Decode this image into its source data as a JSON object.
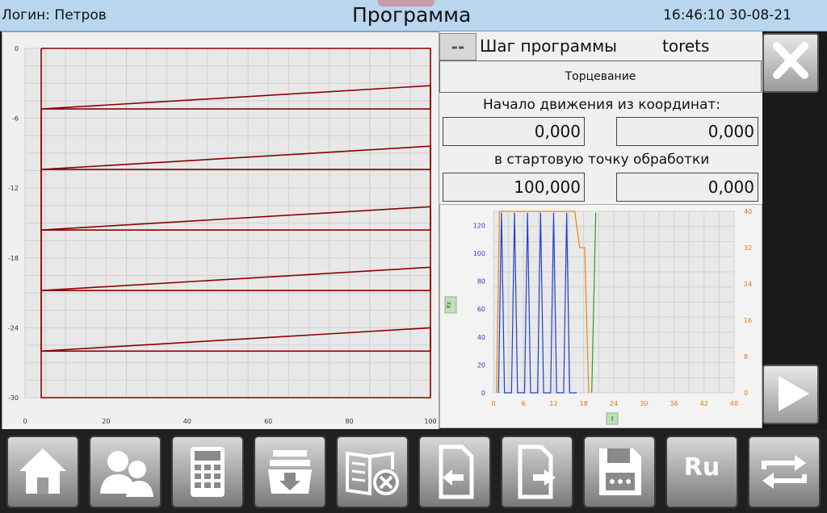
{
  "header": {
    "login": "Логин: Петров",
    "title": "Программа",
    "datetime": "16:46:10 30-08-21"
  },
  "program": {
    "dash_label": "--",
    "step_label": "Шаг программы",
    "step_name": "torets",
    "step_description": "Торцевание",
    "start_label": "Начало движения из координат:",
    "start_x": "0,000",
    "start_z": "0,000",
    "target_label": "в стартовую точку обработки",
    "target_x": "100,000",
    "target_z": "0,000"
  },
  "chart_data": [
    {
      "type": "line",
      "x_ticks": [
        "0",
        "20",
        "40",
        "60",
        "80",
        "100"
      ],
      "y_ticks": [
        "0",
        "-6",
        "-12",
        "-18",
        "-24",
        "-30"
      ],
      "xlim": [
        0,
        100
      ],
      "ylim": [
        -30,
        0
      ],
      "grid": true,
      "series": [
        {
          "values": [
            [
              4,
              0
            ],
            [
              100,
              0
            ],
            [
              100,
              -30
            ],
            [
              4,
              -30
            ],
            [
              4,
              0
            ]
          ]
        },
        {
          "values": [
            [
              4,
              -5.2
            ],
            [
              100,
              -3.2
            ],
            [
              100,
              -5.2
            ],
            [
              4,
              -5.2
            ],
            [
              4,
              -10.4
            ],
            [
              100,
              -8.4
            ],
            [
              100,
              -10.4
            ],
            [
              4,
              -10.4
            ],
            [
              4,
              -15.6
            ],
            [
              100,
              -13.6
            ],
            [
              100,
              -15.6
            ],
            [
              4,
              -15.6
            ],
            [
              4,
              -20.8
            ],
            [
              100,
              -18.8
            ],
            [
              100,
              -20.8
            ],
            [
              4,
              -20.8
            ],
            [
              4,
              -26
            ],
            [
              100,
              -24
            ],
            [
              100,
              -26
            ],
            [
              4,
              -26
            ]
          ]
        }
      ],
      "color": "#8b0000"
    },
    {
      "type": "line",
      "x_ticks": [
        "0",
        "6",
        "12",
        "18",
        "24",
        "30",
        "36",
        "42",
        "48"
      ],
      "y_ticks_left": [
        "0",
        "20",
        "40",
        "60",
        "80",
        "100",
        "120"
      ],
      "y_ticks_right": [
        "0",
        "8",
        "16",
        "24",
        "32",
        "40"
      ],
      "xlabel": "I",
      "ylabel": "Fz",
      "xlim": [
        0,
        48
      ],
      "ylim_left": [
        0,
        130
      ],
      "ylim_right": [
        0,
        40
      ],
      "grid": true,
      "series": [
        {
          "color": "#1f3fcf",
          "values": [
            [
              1,
              0
            ],
            [
              1.6,
              129
            ],
            [
              2.2,
              0
            ],
            [
              3.6,
              0
            ],
            [
              4.2,
              129
            ],
            [
              4.8,
              0
            ],
            [
              6.2,
              0
            ],
            [
              6.8,
              129
            ],
            [
              7.4,
              0
            ],
            [
              8.8,
              0
            ],
            [
              9.4,
              129
            ],
            [
              10,
              0
            ],
            [
              11.4,
              0
            ],
            [
              12,
              129
            ],
            [
              12.6,
              0
            ],
            [
              14,
              0
            ],
            [
              14.6,
              129
            ],
            [
              15.2,
              0
            ],
            [
              16.6,
              0
            ]
          ]
        },
        {
          "color": "#f0860a",
          "values": [
            [
              0.6,
              0
            ],
            [
              1.2,
              40
            ],
            [
              16.2,
              40
            ],
            [
              17.2,
              32
            ],
            [
              18.2,
              32
            ],
            [
              19,
              0
            ]
          ]
        },
        {
          "color": "#2e9a2e",
          "values": [
            [
              19.6,
              0
            ],
            [
              20.4,
              129
            ]
          ]
        }
      ]
    }
  ],
  "icons": {
    "close": "close-icon",
    "play": "play-icon",
    "toolbar": [
      "home-icon",
      "users-icon",
      "calculator-icon",
      "archive-download-icon",
      "delete-book-icon",
      "import-file-icon",
      "export-file-icon",
      "save-icon",
      "language-icon",
      "swap-icon"
    ]
  },
  "language_button": "Ru"
}
